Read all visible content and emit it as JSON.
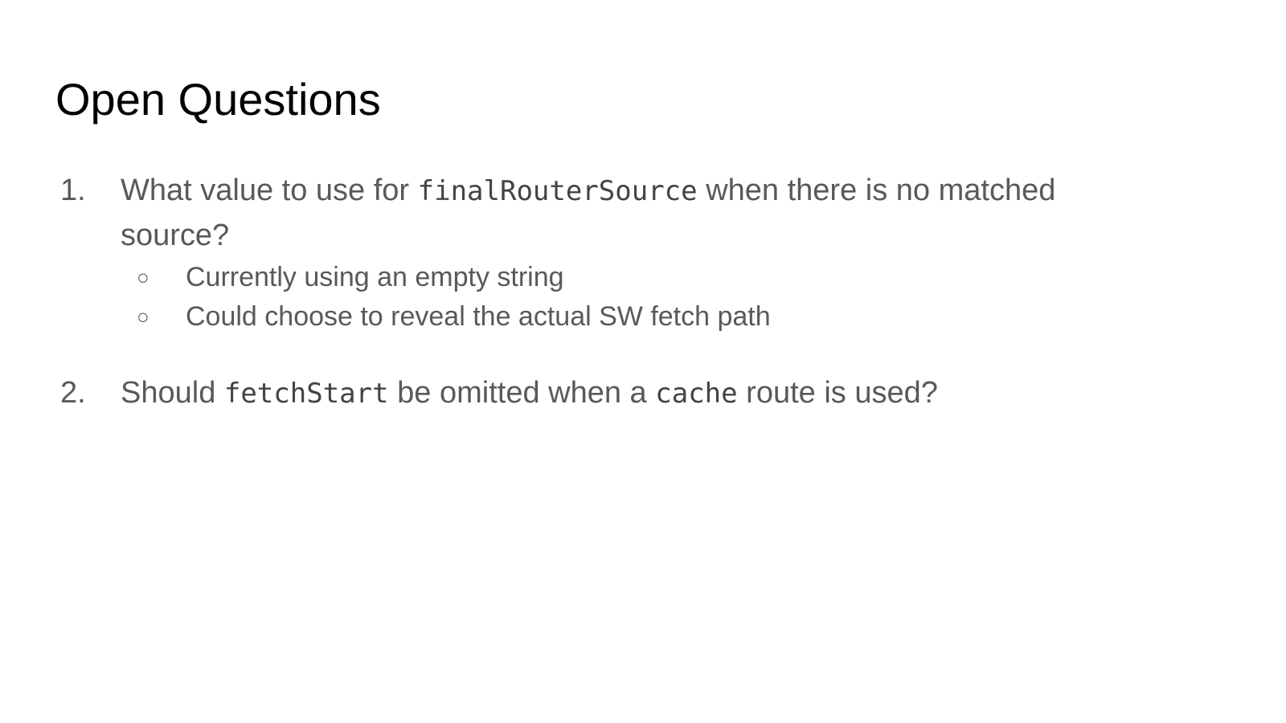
{
  "slide": {
    "title": "Open Questions",
    "questions": [
      {
        "number": "1.",
        "text_before": "What value to use for ",
        "code": "finalRouterSource",
        "text_after": " when there is no matched source?",
        "sub_items": [
          "Currently using an empty string",
          "Could choose to reveal the actual SW fetch path"
        ],
        "bullet": "○"
      },
      {
        "number": "2.",
        "text_before": "Should ",
        "code": "fetchStart",
        "text_middle": " be omitted when a ",
        "code2": "cache",
        "text_after": " route is used?"
      }
    ]
  },
  "colors": {
    "title": "#000000",
    "body": "#595959",
    "background": "#ffffff"
  }
}
